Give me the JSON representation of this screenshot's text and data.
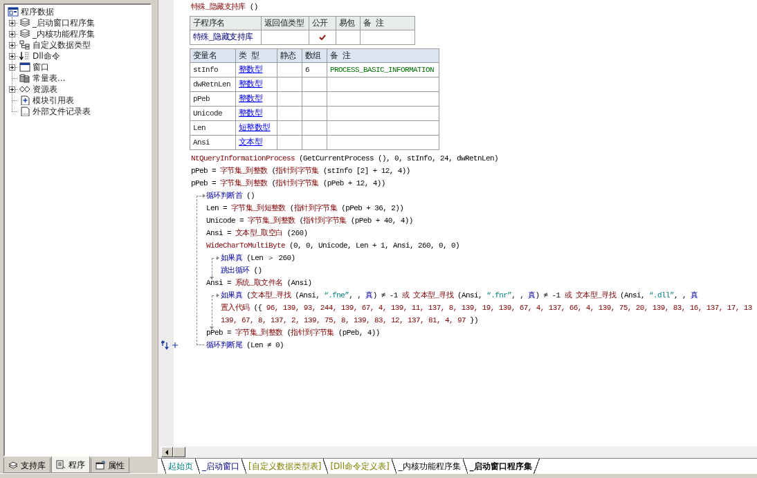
{
  "tree": {
    "label": "程序数据",
    "children": [
      {
        "label": "_启动窗口程序集",
        "expandable": true
      },
      {
        "label": "_内核功能程序集",
        "expandable": true
      },
      {
        "label": "自定义数据类型",
        "expandable": true
      },
      {
        "label": "Dll命令",
        "expandable": true
      },
      {
        "label": "窗口",
        "expandable": true
      },
      {
        "label": "常量表...",
        "expandable": false
      },
      {
        "label": "资源表",
        "expandable": true
      },
      {
        "label": "模块引用表",
        "expandable": false
      },
      {
        "label": "外部文件记录表",
        "expandable": false
      }
    ]
  },
  "left_tabs": [
    {
      "label": "支持库",
      "selected": false
    },
    {
      "label": "程序",
      "selected": true
    },
    {
      "label": "属性",
      "selected": false
    }
  ],
  "subroutine": {
    "title": "特殊_隐藏支持库",
    "params": "()",
    "columns": [
      "子程序名",
      "返回值类型",
      "公开",
      "易包",
      "备 注"
    ],
    "row": {
      "name": "特殊_隐藏支持库",
      "public": true,
      "easy_package": false
    }
  },
  "variables": {
    "columns": [
      "变量名",
      "类 型",
      "静态",
      "数组",
      "备 注"
    ],
    "rows": [
      {
        "name": "stInfo",
        "type": "整数型",
        "static": false,
        "array": "6",
        "note": "PROCESS_BASIC_INFORMATION"
      },
      {
        "name": "dwRetnLen",
        "type": "整数型",
        "static": false
      },
      {
        "name": "pPeb",
        "type": "整数型",
        "static": false
      },
      {
        "name": "Unicode",
        "type": "整数型",
        "static": false
      },
      {
        "name": "Len",
        "type": "短整数型",
        "static": false
      },
      {
        "name": "Ansi",
        "type": "文本型",
        "static": false
      }
    ]
  },
  "code": [
    {
      "kind": "stmt",
      "tokens": [
        {
          "kind": "fn",
          "text": "NtQueryInformationProcess"
        },
        {
          "kind": "tx",
          "text": " (GetCurrentProcess (), 0, stInfo, 24, dwRetnLen)"
        }
      ]
    },
    {
      "kind": "stmt",
      "tokens": [
        {
          "kind": "tx",
          "text": "pPeb = "
        },
        {
          "kind": "fn",
          "text": "字节集_到整数"
        },
        {
          "kind": "tx",
          "text": " ("
        },
        {
          "kind": "fn",
          "text": "指针到字节集"
        },
        {
          "kind": "tx",
          "text": " (stInfo [2] + 12, 4))"
        }
      ]
    },
    {
      "kind": "stmt",
      "tokens": [
        {
          "kind": "tx",
          "text": "pPeb = "
        },
        {
          "kind": "fn",
          "text": "字节集_到整数"
        },
        {
          "kind": "tx",
          "text": " ("
        },
        {
          "kind": "fn",
          "text": "指针到字节集"
        },
        {
          "kind": "tx",
          "text": " (pPeb + 12, 4))"
        }
      ]
    },
    {
      "kind": "loop",
      "head": [
        {
          "kind": "kw",
          "text": "循环判断首"
        },
        {
          "kind": "tx",
          "text": " ()"
        }
      ],
      "children": [
        {
          "kind": "stmt",
          "tokens": [
            {
              "kind": "tx",
              "text": "Len = "
            },
            {
              "kind": "fn",
              "text": "字节集_到短整数"
            },
            {
              "kind": "tx",
              "text": " ("
            },
            {
              "kind": "fn",
              "text": "指针到字节集"
            },
            {
              "kind": "tx",
              "text": " (pPeb + 36, 2))"
            }
          ]
        },
        {
          "kind": "stmt",
          "tokens": [
            {
              "kind": "tx",
              "text": "Unicode = "
            },
            {
              "kind": "fn",
              "text": "字节集_到整数"
            },
            {
              "kind": "tx",
              "text": " ("
            },
            {
              "kind": "fn",
              "text": "指针到字节集"
            },
            {
              "kind": "tx",
              "text": " (pPeb + 40, 4))"
            }
          ]
        },
        {
          "kind": "stmt",
          "tokens": [
            {
              "kind": "tx",
              "text": "Ansi = "
            },
            {
              "kind": "fn",
              "text": "文本型_取空白"
            },
            {
              "kind": "tx",
              "text": " (260)"
            }
          ]
        },
        {
          "kind": "stmt",
          "tokens": [
            {
              "kind": "fn",
              "text": "WideCharToMultiByte"
            },
            {
              "kind": "tx",
              "text": " (0, 0, Unicode, Len + 1, Ansi, 260, 0, 0)"
            }
          ]
        },
        {
          "kind": "if",
          "head": [
            {
              "kind": "kw",
              "text": "如果真"
            },
            {
              "kind": "tx",
              "text": " (Len ＞ 260)"
            }
          ],
          "children": [
            {
              "kind": "stmt",
              "tokens": [
                {
                  "kind": "kw",
                  "text": "跳出循环"
                },
                {
                  "kind": "tx",
                  "text": " ()"
                }
              ]
            }
          ]
        },
        {
          "kind": "stmt",
          "tokens": [
            {
              "kind": "tx",
              "text": "Ansi = "
            },
            {
              "kind": "fn",
              "text": "系统_取文件名"
            },
            {
              "kind": "tx",
              "text": " (Ansi)"
            }
          ]
        },
        {
          "kind": "if",
          "head": [
            {
              "kind": "kw",
              "text": "如果真"
            },
            {
              "kind": "tx",
              "text": " ("
            },
            {
              "kind": "fn",
              "text": "文本型_寻找"
            },
            {
              "kind": "tx",
              "text": " (Ansi, "
            },
            {
              "kind": "str",
              "text": "“.fne”"
            },
            {
              "kind": "tx",
              "text": ", , "
            },
            {
              "kind": "kw",
              "text": "真"
            },
            {
              "kind": "tx",
              "text": ") ≠ -1 "
            },
            {
              "kind": "fn",
              "text": "或 文本型_寻找"
            },
            {
              "kind": "tx",
              "text": " (Ansi, "
            },
            {
              "kind": "str",
              "text": "“.fnr”"
            },
            {
              "kind": "tx",
              "text": ", , "
            },
            {
              "kind": "kw",
              "text": "真"
            },
            {
              "kind": "tx",
              "text": ") ≠ -1 "
            },
            {
              "kind": "fn",
              "text": "或 文本型_寻找"
            },
            {
              "kind": "tx",
              "text": " (Ansi, "
            },
            {
              "kind": "str",
              "text": "“.dll”"
            },
            {
              "kind": "tx",
              "text": ", , "
            },
            {
              "kind": "kw",
              "text": "真"
            }
          ],
          "children": [
            {
              "kind": "stmt",
              "tokens": [
                {
                  "kind": "fn",
                  "text": "置入代码"
                },
                {
                  "kind": "tx",
                  "text": " ({ "
                },
                {
                  "kind": "fn",
                  "text": "96, 139, 93, 244, 139, 67, 4, 139, 11, 137, 8, 139, 19, 139, 67, 4, 137, 66, 4, 139, 75, 20, 139, 83, 16, 137, 17, 13"
                }
              ],
              "continuation": [
                {
                  "kind": "fn",
                  "text": "139, 67, 8, 137, 2, 139, 75, 8, 139, 83, 12, 137, 81, 4, 97"
                },
                {
                  "kind": "tx",
                  "text": " })"
                }
              ]
            }
          ]
        },
        {
          "kind": "stmt",
          "tokens": [
            {
              "kind": "tx",
              "text": "pPeb = "
            },
            {
              "kind": "fn",
              "text": "字节集_到整数"
            },
            {
              "kind": "tx",
              "text": " ("
            },
            {
              "kind": "fn",
              "text": "指针到字节集"
            },
            {
              "kind": "tx",
              "text": " (pPeb, 4))"
            }
          ]
        }
      ],
      "tail": [
        {
          "kind": "kw",
          "text": "循环判断尾"
        },
        {
          "kind": "tx",
          "text": " (Len ≠ 0)"
        }
      ]
    }
  ],
  "editor_tabs": [
    {
      "label": "起始页",
      "kind": "start",
      "selected": false
    },
    {
      "label": "_启动窗口",
      "kind": "form",
      "selected": false
    },
    {
      "label": "[自定义数据类型表]",
      "kind": "table",
      "selected": false
    },
    {
      "label": "[Dll命令定义表]",
      "kind": "table",
      "selected": false
    },
    {
      "label": "_内核功能程序集",
      "kind": "module",
      "selected": false
    },
    {
      "label": "_启动窗口程序集",
      "kind": "module",
      "selected": true
    }
  ]
}
